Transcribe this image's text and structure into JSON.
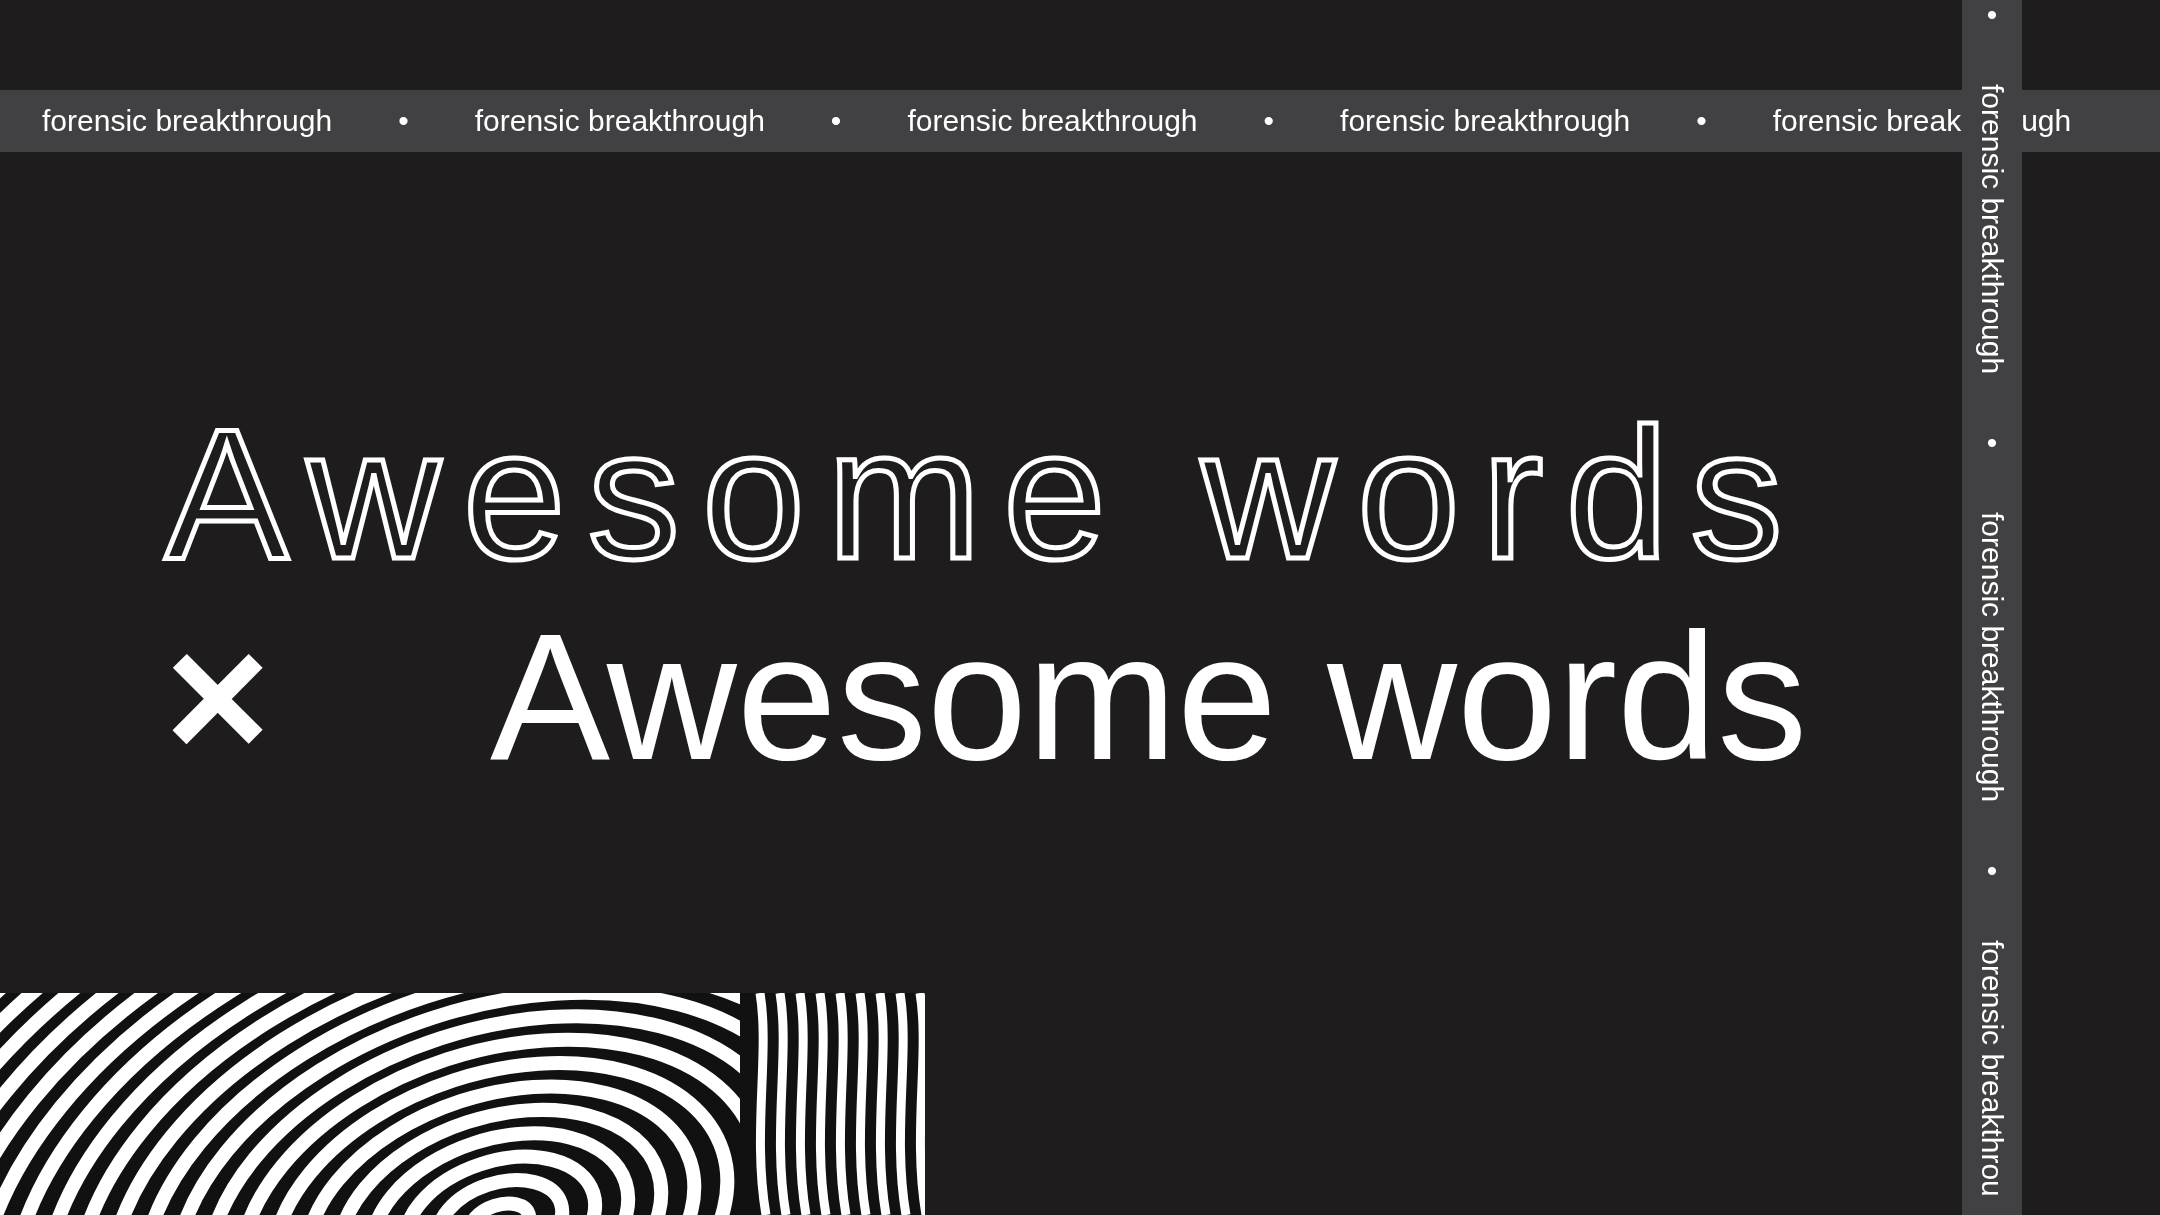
{
  "top_band": {
    "items": [
      {
        "kind": "text",
        "text": "forensic breakthrough"
      },
      {
        "kind": "dot",
        "text": "•"
      },
      {
        "kind": "text",
        "text": "forensic breakthrough"
      },
      {
        "kind": "dot",
        "text": "•"
      },
      {
        "kind": "text",
        "text": "forensic breakthrough"
      },
      {
        "kind": "dot",
        "text": "•"
      },
      {
        "kind": "text",
        "text": "forensic breakthrough"
      },
      {
        "kind": "dot",
        "text": "•"
      },
      {
        "kind": "text",
        "text": "forensic break"
      },
      {
        "kind": "tail",
        "text": "ugh"
      }
    ]
  },
  "side_band": {
    "items": [
      {
        "kind": "dot",
        "text": "•"
      },
      {
        "kind": "text",
        "text": "forensic breakthrough"
      },
      {
        "kind": "dot",
        "text": "•"
      },
      {
        "kind": "text",
        "text": "forensic breakthrough"
      },
      {
        "kind": "dot",
        "text": "•"
      },
      {
        "kind": "text",
        "text": "forensic breakthrou"
      }
    ]
  },
  "headline_outline": "Awesome words",
  "headline_mark": "×",
  "headline_solid": "Awesome words"
}
